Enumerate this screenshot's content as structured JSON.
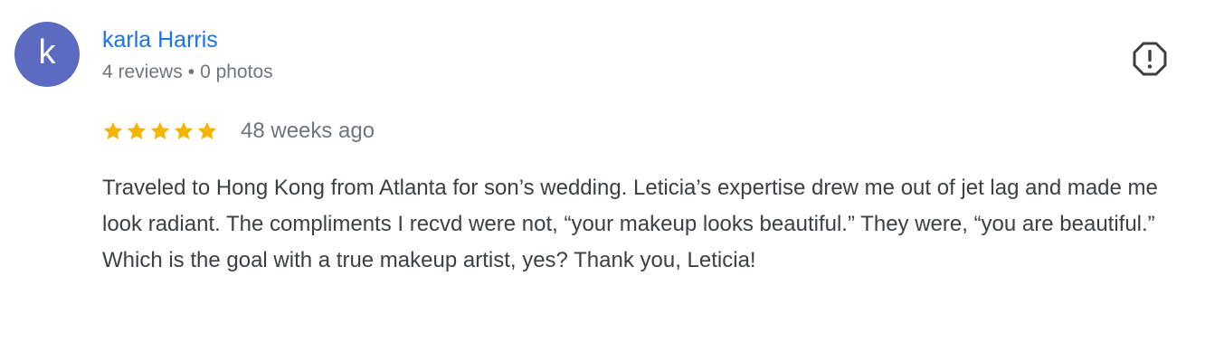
{
  "review": {
    "avatar_letter": "k",
    "avatar_color": "#5c6bc0",
    "author_name": "karla Harris",
    "reviews_count": "4 reviews",
    "separator": "•",
    "photos_count": "0 photos",
    "rating": 5,
    "max_rating": 5,
    "star_color": "#f4b400",
    "time_ago": "48 weeks ago",
    "text": "Traveled to Hong Kong from Atlanta for son’s wedding. Leticia’s expertise drew me out of jet lag and made me look radiant. The compliments I recvd were not, “your makeup looks beautiful.” They were, “you are beautiful.” Which is the goal with a true makeup artist, yes? Thank you, Leticia!",
    "flag_icon": "report-flag-icon"
  }
}
